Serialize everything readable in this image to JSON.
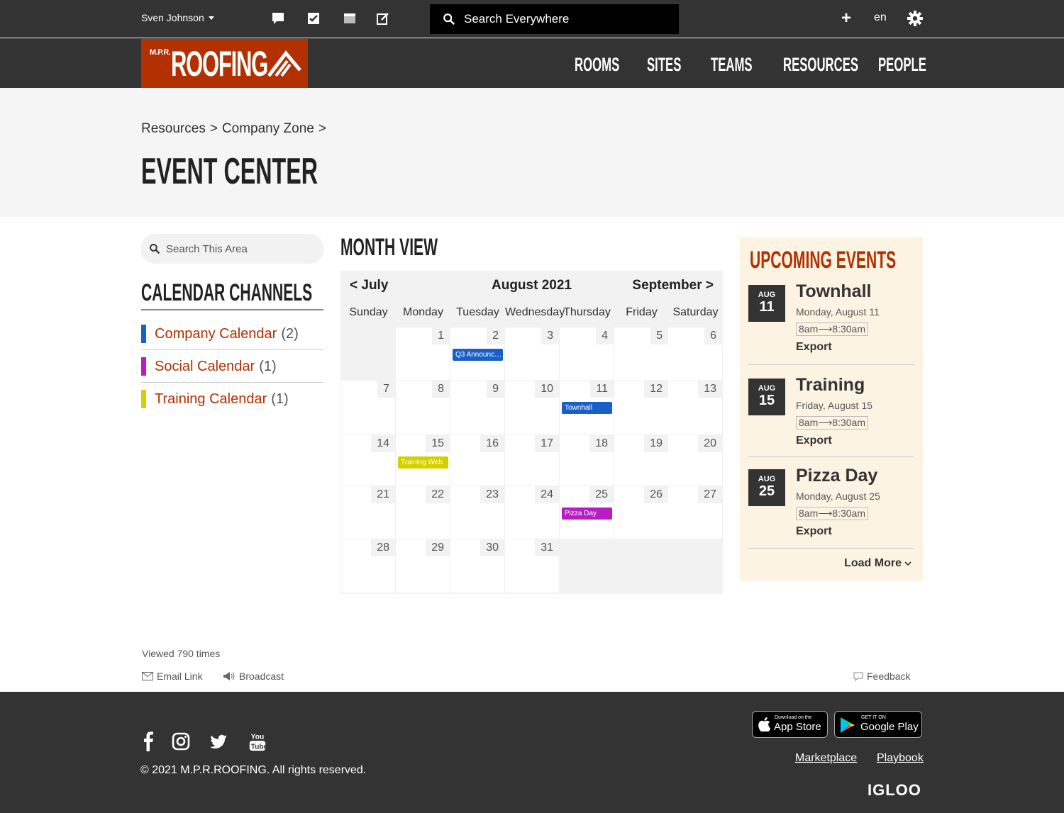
{
  "topbar": {
    "user_name": "Sven Johnson",
    "search_placeholder": "Search Everywhere",
    "lang": "en",
    "icons": [
      "chat-icon",
      "tasks-check-icon",
      "inbox-icon",
      "compose-icon",
      "plus-icon",
      "gear-icon"
    ]
  },
  "header": {
    "logo_small": "M.P.R.",
    "logo_big": "ROOFING",
    "nav": [
      "ROOMS",
      "SITES",
      "TEAMS",
      "RESOURCES",
      "PEOPLE"
    ]
  },
  "hero": {
    "breadcrumb": [
      "Resources",
      ">",
      "Company Zone",
      ">"
    ],
    "title": "EVENT CENTER"
  },
  "sidebar": {
    "search_placeholder": "Search This Area",
    "channels_title": "CALENDAR CHANNELS",
    "channels": [
      {
        "name": "Company Calendar",
        "count": "(2)",
        "color": "#1a5fc7"
      },
      {
        "name": "Social Calendar",
        "count": "(1)",
        "color": "#b91cc4"
      },
      {
        "name": "Training Calendar",
        "count": "(1)",
        "color": "#d4d000"
      }
    ]
  },
  "calendar": {
    "title": "MONTH VIEW",
    "prev": "< July",
    "month": "August 2021",
    "next": "September >",
    "weekdays": [
      "Sunday",
      "Monday",
      "Tuesday",
      "Wednesday",
      "Thursday",
      "Friday",
      "Saturday"
    ],
    "weeks": [
      [
        "",
        "1",
        "2",
        "3",
        "4",
        "5",
        "6"
      ],
      [
        "7",
        "8",
        "9",
        "10",
        "11",
        "12",
        "13"
      ],
      [
        "14",
        "15",
        "16",
        "17",
        "18",
        "19",
        "20"
      ],
      [
        "21",
        "22",
        "23",
        "24",
        "25",
        "26",
        "27"
      ],
      [
        "28",
        "29",
        "30",
        "31",
        "",
        "",
        ""
      ]
    ],
    "events": [
      {
        "week": 0,
        "day": 2,
        "label": "Q3 Announce...",
        "color": "#1a5fc7"
      },
      {
        "week": 1,
        "day": 4,
        "label": "Townhall",
        "color": "#1a5fc7"
      },
      {
        "week": 2,
        "day": 1,
        "label": "Training Web",
        "color": "#d4d000"
      },
      {
        "week": 3,
        "day": 4,
        "label": "Pizza Day",
        "color": "#b91cc4"
      }
    ]
  },
  "upcoming": {
    "title": "UPCOMING EVENTS",
    "items": [
      {
        "month": "AUG",
        "day": "11",
        "name": "Townhall",
        "date": "Monday, August 11",
        "time": "8am⟶8:30am",
        "export": "Export"
      },
      {
        "month": "AUG",
        "day": "15",
        "name": "Training",
        "date": "Friday, August 15",
        "time": "8am⟶8:30am",
        "export": "Export"
      },
      {
        "month": "AUG",
        "day": "25",
        "name": "Pizza Day",
        "date": "Monday, August 25",
        "time": "8am⟶8:30am",
        "export": "Export"
      }
    ],
    "load_more": "Load More"
  },
  "meta": {
    "viewed": "Viewed 790 times",
    "email_link": "Email Link",
    "broadcast": "Broadcast",
    "feedback": "Feedback"
  },
  "footer": {
    "copyright": "© 2021 M.P.R.ROOFING. All rights reserved.",
    "app_store_small": "Download on the",
    "app_store_big": "App Store",
    "google_small": "GET IT ON",
    "google_big": "Google Play",
    "links": [
      "Marketplace",
      "Playbook"
    ],
    "brand": "IGLOO",
    "social": [
      "facebook-icon",
      "instagram-icon",
      "twitter-icon",
      "youtube-icon"
    ]
  }
}
